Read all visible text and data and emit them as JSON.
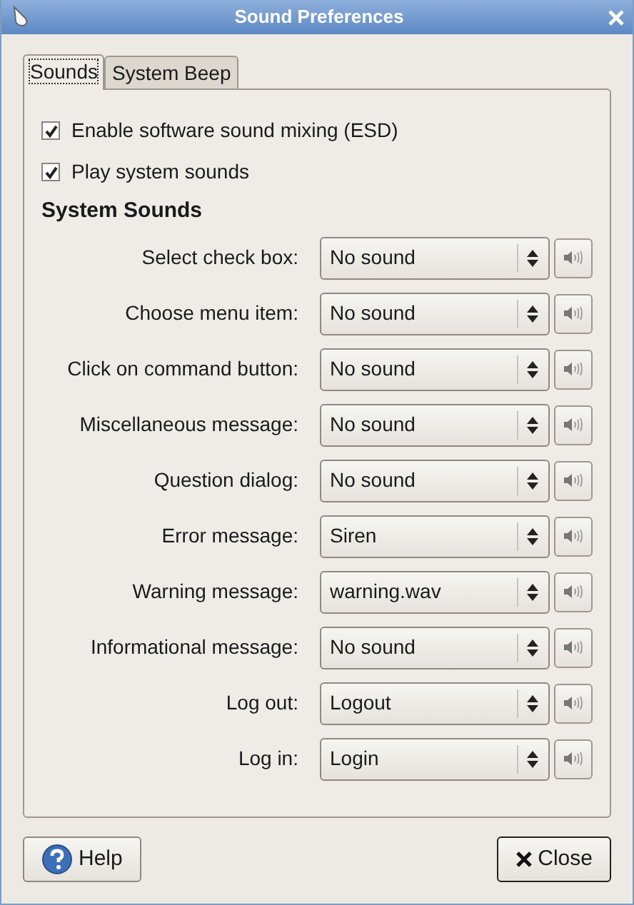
{
  "window": {
    "title": "Sound Preferences"
  },
  "tabs": [
    {
      "label": "Sounds",
      "selected": true
    },
    {
      "label": "System Beep",
      "selected": false
    }
  ],
  "options": [
    {
      "label": "Enable software sound mixing (ESD)",
      "checked": true
    },
    {
      "label": "Play system sounds",
      "checked": true
    }
  ],
  "section_title": "System Sounds",
  "sounds": [
    {
      "label": "Select check box:",
      "value": "No sound"
    },
    {
      "label": "Choose menu item:",
      "value": "No sound"
    },
    {
      "label": "Click on command button:",
      "value": "No sound"
    },
    {
      "label": "Miscellaneous message:",
      "value": "No sound"
    },
    {
      "label": "Question dialog:",
      "value": "No sound"
    },
    {
      "label": "Error message:",
      "value": "Siren"
    },
    {
      "label": "Warning message:",
      "value": "warning.wav"
    },
    {
      "label": "Informational message:",
      "value": "No sound"
    },
    {
      "label": "Log out:",
      "value": "Logout"
    },
    {
      "label": "Log in:",
      "value": "Login"
    }
  ],
  "buttons": [
    {
      "kind": "help",
      "label": "Help"
    },
    {
      "kind": "close",
      "label": "Close"
    }
  ]
}
